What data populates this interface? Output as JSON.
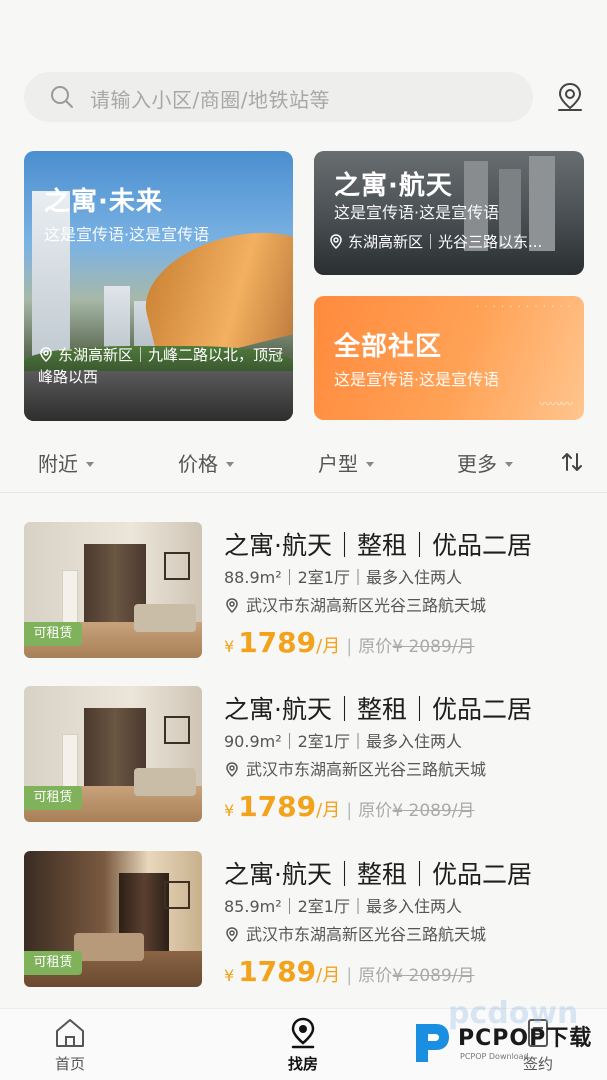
{
  "search": {
    "placeholder": "请输入小区/商圈/地铁站等"
  },
  "banners": {
    "left": {
      "title": "之寓·未来",
      "slogan": "这是宣传语·这是宣传语",
      "address": "东湖高新区｜九峰二路以北，顶冠峰路以西"
    },
    "right_top": {
      "title": "之寓·航天",
      "slogan": "这是宣传语·这是宣传语",
      "address": "东湖高新区｜光谷三路以东..."
    },
    "right_bottom": {
      "title": "全部社区",
      "slogan": "这是宣传语·这是宣传语"
    }
  },
  "filters": {
    "nearby": "附近",
    "price": "价格",
    "layout": "户型",
    "more": "更多"
  },
  "listings": [
    {
      "tag": "可租赁",
      "name": "之寓·航天｜整租｜优品二居",
      "spec": "88.9m²｜2室1厅｜最多入住两人",
      "location": "武汉市东湖高新区光谷三路航天城",
      "currency": "¥",
      "price": "1789",
      "unit": "/月",
      "orig_label": "原价",
      "orig_price": "¥ 2089/月"
    },
    {
      "tag": "可租赁",
      "name": "之寓·航天｜整租｜优品二居",
      "spec": "90.9m²｜2室1厅｜最多入住两人",
      "location": "武汉市东湖高新区光谷三路航天城",
      "currency": "¥",
      "price": "1789",
      "unit": "/月",
      "orig_label": "原价",
      "orig_price": "¥ 2089/月"
    },
    {
      "tag": "可租赁",
      "name": "之寓·航天｜整租｜优品二居",
      "spec": "85.9m²｜2室1厅｜最多入住两人",
      "location": "武汉市东湖高新区光谷三路航天城",
      "currency": "¥",
      "price": "1789",
      "unit": "/月",
      "orig_label": "原价",
      "orig_price": "¥ 2089/月"
    }
  ],
  "tabbar": {
    "home": "首页",
    "find": "找房",
    "sign": "签约"
  },
  "watermark": {
    "brand": "PCPOP下载",
    "sub": "PCPOP Download"
  },
  "colors": {
    "accent": "#f3a21c",
    "tag_green": "#7fb25a",
    "orange_card": "#ff8a3d"
  }
}
